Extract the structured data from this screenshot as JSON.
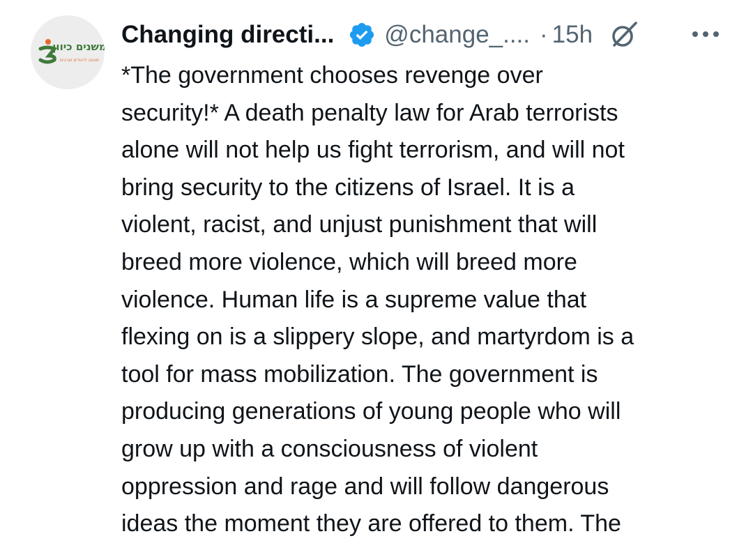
{
  "author": {
    "display_name": "Changing directi...",
    "handle": "@change_....",
    "separator": "·",
    "time": "15h",
    "verified_icon": "verified-badge-icon",
    "grok_icon": "grok-icon",
    "more_icon": "more-options-icon",
    "avatar_text": "משנים כיוון",
    "avatar_subtext": "תנועה ליהודים וערבים"
  },
  "tweet": {
    "lines": [
      "*The government chooses revenge over",
      "security!* A death penalty law for Arab terrorists",
      "alone will not help us fight terrorism, and will not",
      "bring security to the citizens of Israel. It is a",
      "violent, racist, and unjust punishment that will",
      "breed more violence, which will breed more",
      "violence. Human life is a supreme value that",
      "flexing on is a slippery slope, and martyrdom is a",
      "tool for mass mobilization. The government is",
      "producing generations of young people who will",
      "grow up with a consciousness of violent",
      "oppression and rage and will follow dangerous",
      "ideas the moment they are offered to them. The"
    ]
  },
  "colors": {
    "text_primary": "#0f1419",
    "text_secondary": "#536471",
    "verified_blue": "#1d9bf0",
    "avatar_bg": "#ededed",
    "logo_green": "#3f7a3a",
    "logo_orange": "#e8692c"
  }
}
